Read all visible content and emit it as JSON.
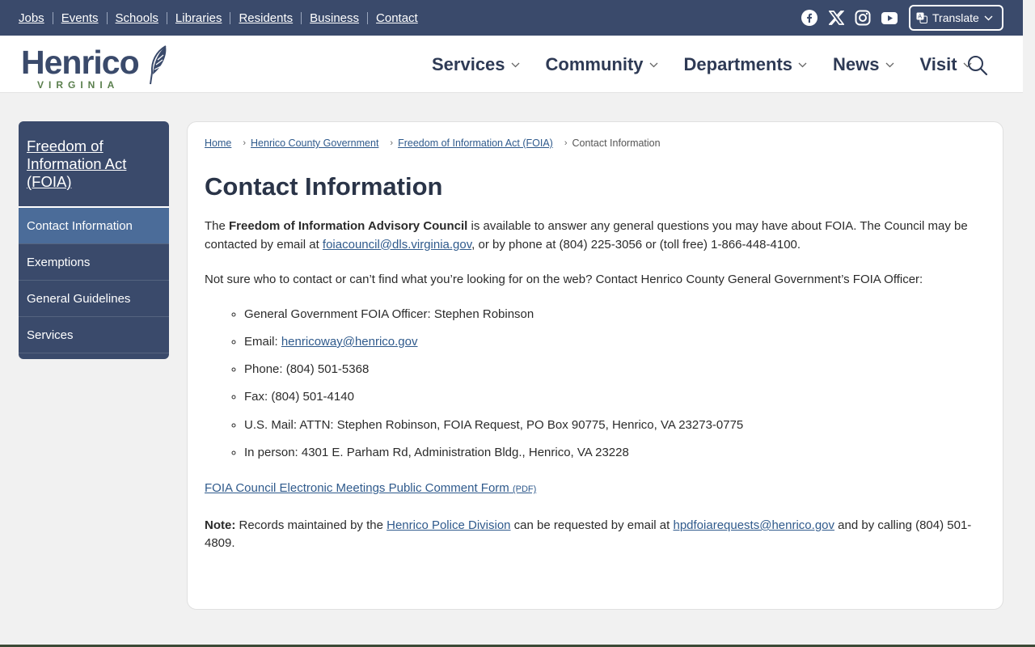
{
  "utility": {
    "links": [
      "Jobs",
      "Events",
      "Schools",
      "Libraries",
      "Residents",
      "Business",
      "Contact"
    ],
    "social_icons": [
      "facebook-icon",
      "x-icon",
      "instagram-icon",
      "youtube-icon"
    ],
    "translate_label": "Translate"
  },
  "header": {
    "logo_word": "Henrico",
    "logo_sub": "VIRGINIA",
    "nav": [
      "Services",
      "Community",
      "Departments",
      "News",
      "Visit"
    ]
  },
  "sidebar": {
    "title": "Freedom of Information Act (FOIA)",
    "items": [
      {
        "label": "Contact Information",
        "active": true
      },
      {
        "label": "Exemptions",
        "active": false
      },
      {
        "label": "General Guidelines",
        "active": false
      },
      {
        "label": "Services",
        "active": false
      }
    ]
  },
  "breadcrumb": {
    "items": [
      "Home",
      "Henrico County Government",
      "Freedom of Information Act (FOIA)"
    ],
    "current": "Contact Information"
  },
  "page": {
    "title": "Contact Information",
    "p1_a": "The ",
    "p1_bold": "Freedom of Information Advisory Council",
    "p1_b": " is available to answer any general questions you may have about FOIA.  The Council may be contacted by email at ",
    "p1_link": "foiacouncil@dls.virginia.gov",
    "p1_c": ", or by phone at (804) 225-3056 or (toll free) 1-866-448-4100.",
    "p2": "Not sure who to contact or can’t find what you’re looking for on the web? Contact Henrico County General Government’s FOIA Officer:",
    "officer": "General Government FOIA Officer: Stephen Robinson",
    "email_label": "Email: ",
    "email_link": "henricoway@henrico.gov",
    "phone": "Phone: (804) 501-5368",
    "fax": "Fax: (804) 501-4140",
    "mail": "U.S. Mail: ATTN: Stephen Robinson, FOIA Request, PO Box 90775, Henrico, VA  23273-0775",
    "in_person": "In person:  4301 E. Parham Rd, Administration Bldg., Henrico, VA 23228",
    "pdf_link": "FOIA Council Electronic Meetings Public Comment Form",
    "pdf_tag": "(PDF)",
    "note_label": "Note:",
    "note_a": " Records maintained by the ",
    "note_link1": "Henrico Police Division",
    "note_b": " can be requested by email at ",
    "note_link2": "hpdfoiarequests@henrico.gov",
    "note_c": " and by calling (804) 501-4809."
  }
}
